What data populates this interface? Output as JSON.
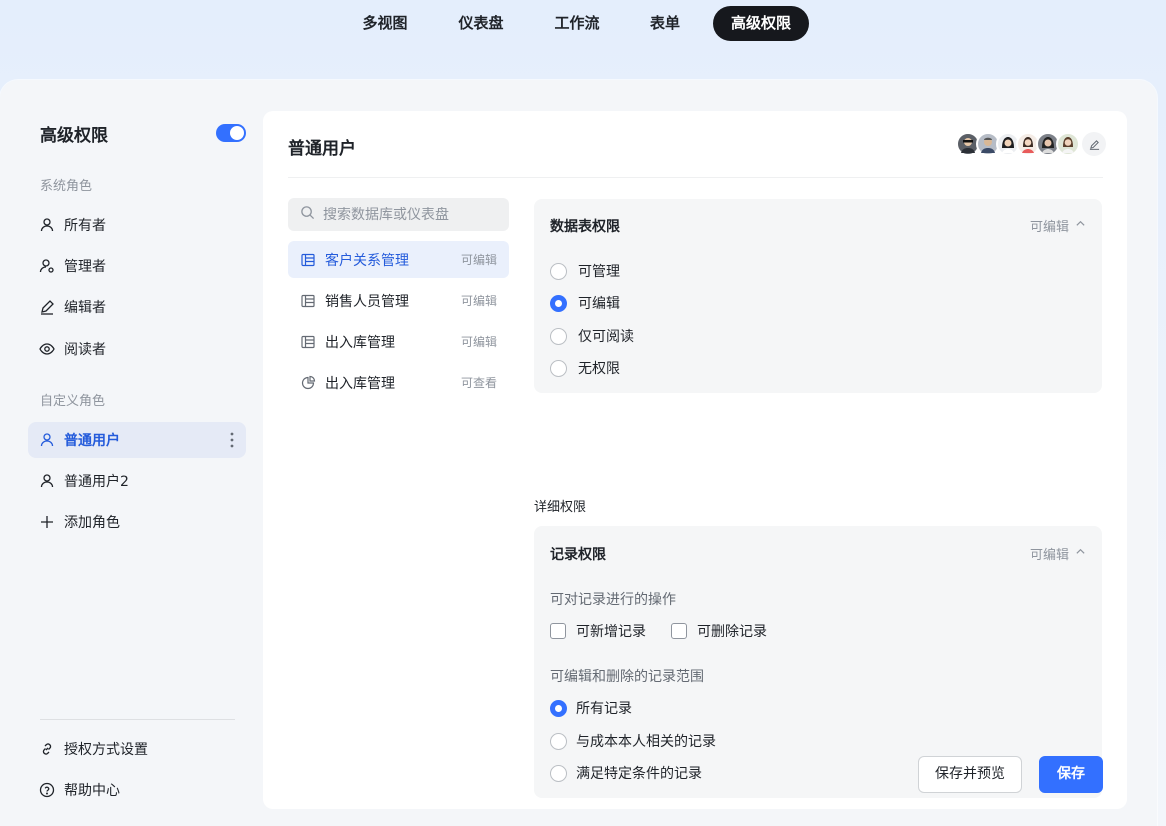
{
  "top_tabs": [
    {
      "label": "多视图"
    },
    {
      "label": "仪表盘"
    },
    {
      "label": "工作流"
    },
    {
      "label": "表单"
    },
    {
      "label": "高级权限",
      "active": true
    }
  ],
  "sidebar": {
    "title": "高级权限",
    "toggle_on": true,
    "system_roles_label": "系统角色",
    "system_roles": [
      {
        "label": "所有者",
        "icon": "user-icon"
      },
      {
        "label": "管理者",
        "icon": "user-gear-icon"
      },
      {
        "label": "编辑者",
        "icon": "pencil-icon"
      },
      {
        "label": "阅读者",
        "icon": "eye-icon"
      }
    ],
    "custom_roles_label": "自定义角色",
    "custom_roles": [
      {
        "label": "普通用户",
        "icon": "user-icon",
        "active": true
      },
      {
        "label": "普通用户2",
        "icon": "user-icon"
      }
    ],
    "add_role_label": "添加角色",
    "footer": [
      {
        "label": "授权方式设置",
        "icon": "link-icon"
      },
      {
        "label": "帮助中心",
        "icon": "help-icon"
      }
    ]
  },
  "panel": {
    "title": "普通用户",
    "avatar_count": 6,
    "search_placeholder": "搜索数据库或仪表盘",
    "databases": [
      {
        "name": "客户关系管理",
        "status": "可编辑",
        "icon": "table-icon",
        "active": true
      },
      {
        "name": "销售人员管理",
        "status": "可编辑",
        "icon": "table-icon"
      },
      {
        "name": "出入库管理",
        "status": "可编辑",
        "icon": "table-icon"
      },
      {
        "name": "出入库管理",
        "status": "可查看",
        "icon": "dashboard-icon"
      }
    ],
    "table_permission": {
      "title": "数据表权限",
      "status": "可编辑",
      "options": [
        "可管理",
        "可编辑",
        "仅可阅读",
        "无权限"
      ],
      "selected": "可编辑"
    },
    "detail_label": "详细权限",
    "record_permission": {
      "title": "记录权限",
      "status": "可编辑",
      "ops_label": "可对记录进行的操作",
      "ops": [
        {
          "label": "可新增记录",
          "checked": false
        },
        {
          "label": "可删除记录",
          "checked": false
        }
      ],
      "scope_label": "可编辑和删除的记录范围",
      "scopes": [
        "所有记录",
        "与成本本人相关的记录",
        "满足特定条件的记录"
      ],
      "selected_scope": "所有记录"
    },
    "buttons": {
      "save_preview": "保存并预览",
      "save": "保存"
    }
  },
  "colors": {
    "accent": "#3370ff",
    "active_text": "#245bdb",
    "dark_tab": "#16181d"
  }
}
